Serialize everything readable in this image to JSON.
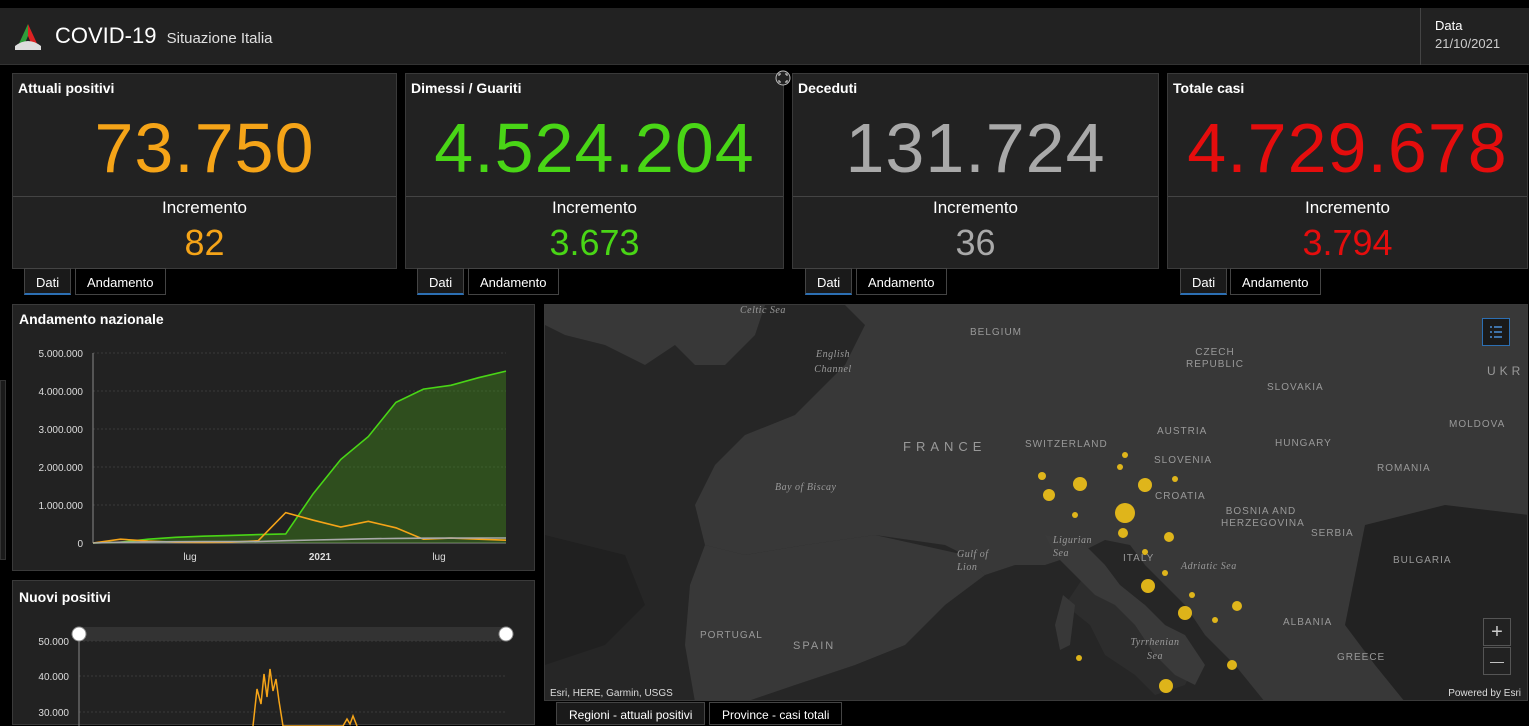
{
  "header": {
    "title": "COVID-19",
    "subtitle": "Situazione Italia",
    "date_label": "Data",
    "date_value": "21/10/2021"
  },
  "cards": [
    {
      "title": "Attuali positivi",
      "value": "73.750",
      "inc_label": "Incremento",
      "inc_value": "82",
      "color": "#f5a418"
    },
    {
      "title": "Dimessi / Guariti",
      "value": "4.524.204",
      "inc_label": "Incremento",
      "inc_value": "3.673",
      "color": "#49d616"
    },
    {
      "title": "Deceduti",
      "value": "131.724",
      "inc_label": "Incremento",
      "inc_value": "36",
      "color": "#a9a9a9"
    },
    {
      "title": "Totale casi",
      "value": "4.729.678",
      "inc_label": "Incremento",
      "inc_value": "3.794",
      "color": "#e50d0d"
    }
  ],
  "tabs": {
    "dati": "Dati",
    "andamento": "Andamento"
  },
  "panels": {
    "andamento_title": "Andamento nazionale",
    "nuovi_title": "Nuovi positivi"
  },
  "chart_data": [
    {
      "type": "line",
      "title": "Andamento nazionale",
      "ylim": [
        0,
        5000000
      ],
      "yticks": [
        "5.000.000",
        "4.000.000",
        "3.000.000",
        "2.000.000",
        "1.000.000",
        "0"
      ],
      "xticks": [
        "lug",
        "2021",
        "lug"
      ],
      "series": [
        {
          "color": "#49d616",
          "values": [
            0,
            20000,
            100000,
            150000,
            180000,
            200000,
            220000,
            240000,
            1300000,
            2200000,
            2800000,
            3700000,
            4050000,
            4150000,
            4350000,
            4524204
          ]
        },
        {
          "color": "#f5a418",
          "values": [
            0,
            100000,
            50000,
            20000,
            15000,
            20000,
            60000,
            800000,
            600000,
            420000,
            570000,
            400000,
            100000,
            130000,
            100000,
            73750
          ]
        },
        {
          "color": "#a9a9a9",
          "values": [
            0,
            20000,
            30000,
            35000,
            36000,
            37000,
            40000,
            60000,
            80000,
            95000,
            110000,
            120000,
            127000,
            130000,
            131000,
            131724
          ]
        }
      ]
    },
    {
      "type": "line",
      "title": "Nuovi positivi",
      "yticks": [
        "50.000",
        "40.000",
        "30.000"
      ],
      "ylim": [
        25000,
        55000
      ]
    }
  ],
  "map": {
    "labels": {
      "celtic_sea": "Celtic Sea",
      "belgium": "BELGIUM",
      "english_channel": "English Channel",
      "czech": "CZECH REPUBLIC",
      "slovakia": "SLOVAKIA",
      "ukr": "UKR",
      "france": "FRANCE",
      "switzerland": "SWITZERLAND",
      "austria": "AUSTRIA",
      "hungary": "HUNGARY",
      "moldova": "MOLDOVA",
      "slovenia": "SLOVENIA",
      "romania": "ROMANIA",
      "croatia": "CROATIA",
      "bay_biscay": "Bay of Biscay",
      "bosnia": "BOSNIA AND HERZEGOVINA",
      "serbia": "SERBIA",
      "ligurian": "Ligurian Sea",
      "gulf_lion": "Gulf of Lion",
      "italy": "ITALY",
      "adriatic": "Adriatic Sea",
      "bulgaria": "BULGARIA",
      "portugal": "PORTUGAL",
      "spain": "SPAIN",
      "albania": "ALBANIA",
      "tyrrhenian": "Tyrrhenian Sea",
      "greece": "GREECE"
    },
    "attribution": "Esri, HERE, Garmin, USGS",
    "powered": "Powered by Esri",
    "zoom_in": "+",
    "zoom_out": "—",
    "tabs": [
      "Regioni - attuali positivi",
      "Province - casi totali"
    ]
  }
}
